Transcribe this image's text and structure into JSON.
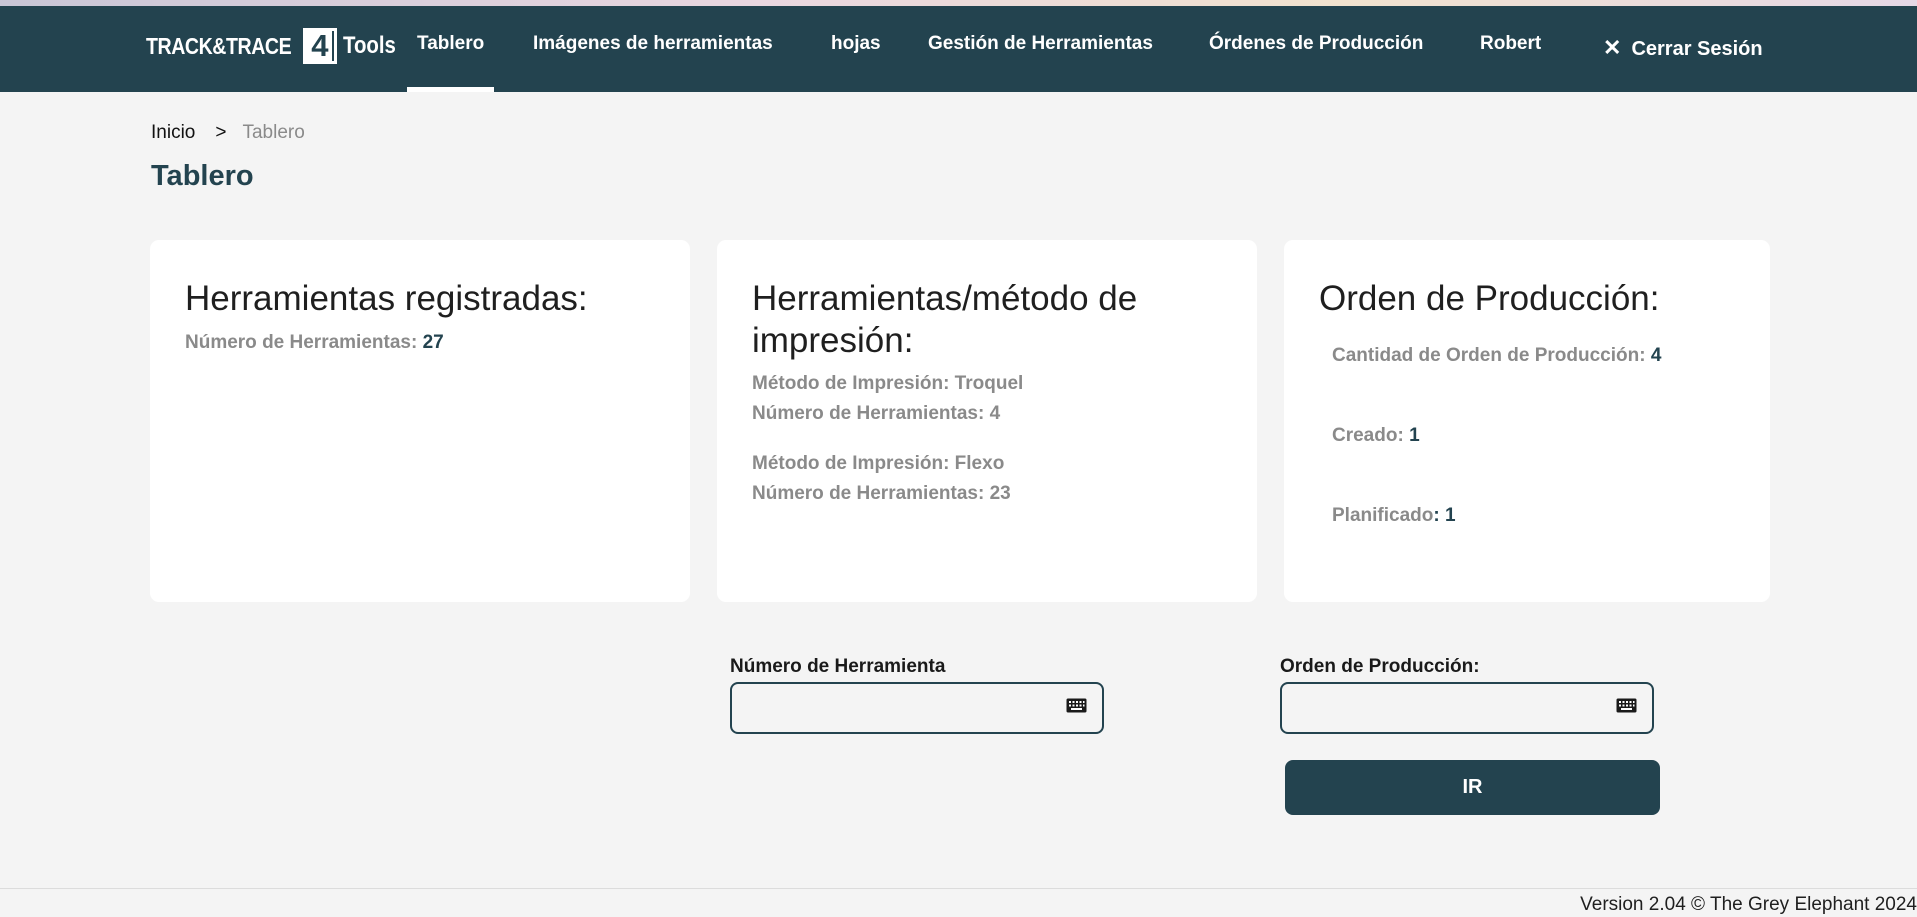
{
  "brand": {
    "logo_text": "TRACK&TRACE",
    "logo_number": "4",
    "logo_suffix": "Tools"
  },
  "nav": {
    "items": [
      {
        "label": "Tablero",
        "active": true
      },
      {
        "label": "Imágenes de herramientas",
        "active": false
      },
      {
        "label": "hojas",
        "active": false
      },
      {
        "label": "Gestión de Herramientas",
        "active": false
      },
      {
        "label": "Órdenes de Producción",
        "active": false
      },
      {
        "label": "Robert",
        "active": false
      }
    ],
    "logout_label": "Cerrar Sesión",
    "logout_icon": "close-icon"
  },
  "breadcrumb": {
    "home": "Inicio",
    "separator": ">",
    "current": "Tablero"
  },
  "page_title": "Tablero",
  "cards": {
    "registered": {
      "title": "Herramientas registradas:",
      "count_label": "Número de Herramientas: ",
      "count_value": "27"
    },
    "by_method": {
      "title_line1": "Herramientas/método de",
      "title_line2": "impresión:",
      "methods": [
        {
          "method_label": "Método de Impresión: Troquel",
          "count_label": "Número de Herramientas: 4"
        },
        {
          "method_label": "Método de Impresión: Flexo",
          "count_label": "Número de Herramientas: 23"
        }
      ]
    },
    "production": {
      "title": "Orden de Producción:",
      "quantity_label": "Cantidad de Orden de Producción: ",
      "quantity_value": "4",
      "created_label": "Creado: ",
      "created_value": "1",
      "planned_label": "Planificado",
      "planned_value": ": 1"
    }
  },
  "search": {
    "tool_number_label": "Número de Herramienta",
    "tool_number_value": "",
    "production_order_label": "Orden de Producción:",
    "production_order_value": "",
    "go_label": "IR"
  },
  "footer": {
    "version_text": "Version 2.04 © The Grey Elephant 2024"
  },
  "colors": {
    "primary": "#23434f",
    "background": "#f4f4f4",
    "card": "#ffffff",
    "muted_text": "#8a8a8a"
  }
}
